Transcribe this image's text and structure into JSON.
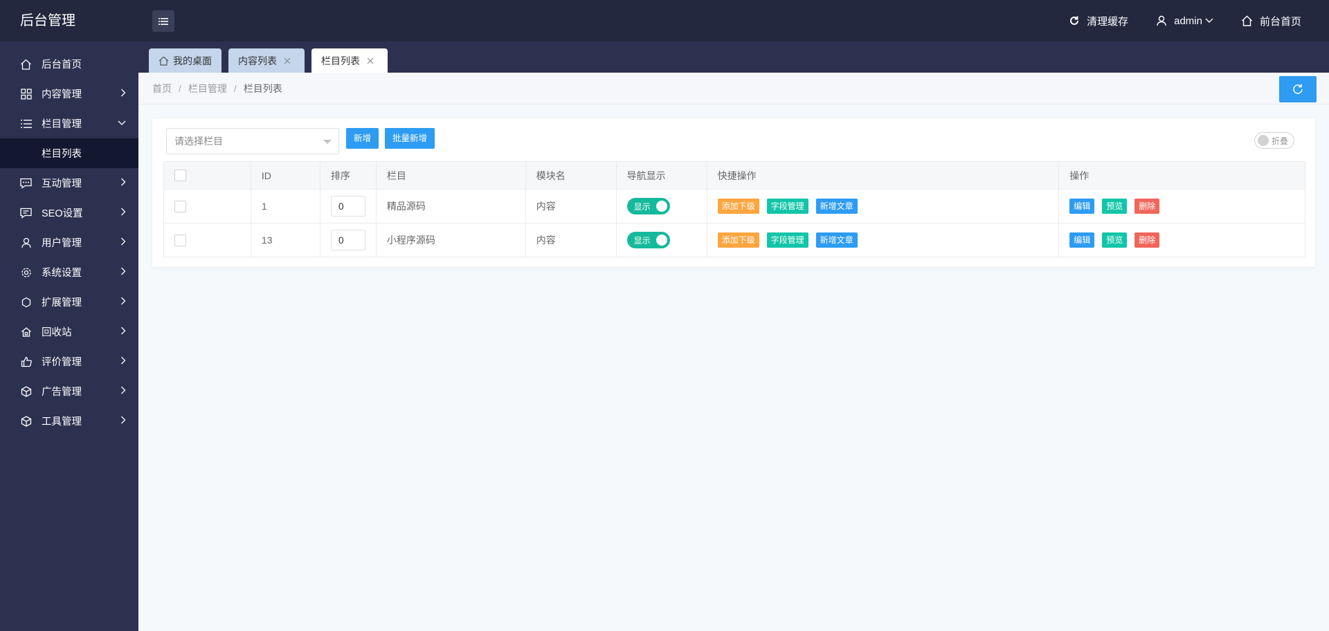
{
  "brand": "后台管理",
  "topbar": {
    "clear_cache": "清理缓存",
    "user": "admin",
    "front_home": "前台首页"
  },
  "sidebar": {
    "items": [
      {
        "label": "后台首页",
        "icon": "home-icon"
      },
      {
        "label": "内容管理",
        "icon": "grid-icon"
      },
      {
        "label": "栏目管理",
        "icon": "list-icon"
      },
      {
        "label": "互动管理",
        "icon": "chat-icon"
      },
      {
        "label": "SEO设置",
        "icon": "comment-icon"
      },
      {
        "label": "用户管理",
        "icon": "user-icon"
      },
      {
        "label": "系统设置",
        "icon": "gear-icon"
      },
      {
        "label": "扩展管理",
        "icon": "extend-icon"
      },
      {
        "label": "回收站",
        "icon": "recycle-icon"
      },
      {
        "label": "评价管理",
        "icon": "thumb-icon"
      },
      {
        "label": "广告管理",
        "icon": "cube-icon"
      },
      {
        "label": "工具管理",
        "icon": "tool-icon"
      }
    ],
    "sub_item": "栏目列表"
  },
  "tabs": [
    {
      "label": "我的桌面"
    },
    {
      "label": "内容列表"
    },
    {
      "label": "栏目列表"
    }
  ],
  "breadcrumb": [
    "首页",
    "栏目管理",
    "栏目列表"
  ],
  "breadcrumb_sep": "/",
  "toolbar": {
    "select_placeholder": "请选择栏目",
    "add_label": "新增",
    "batch_add_label": "批量新增",
    "fold_label": "折叠"
  },
  "table": {
    "headers": [
      "ID",
      "排序",
      "栏目",
      "模块名",
      "导航显示",
      "快捷操作",
      "操作"
    ],
    "rows": [
      {
        "id": "1",
        "sort": "0",
        "name": "精品源码",
        "module": "内容",
        "nav": "显示"
      },
      {
        "id": "13",
        "sort": "0",
        "name": "小程序源码",
        "module": "内容",
        "nav": "显示"
      }
    ],
    "quick_actions": [
      "添加下级",
      "字段管理",
      "新增文章"
    ],
    "actions": [
      "编辑",
      "预览",
      "删除"
    ]
  },
  "colors": {
    "header_bg": "#23283f",
    "sidebar_bg": "#2d3150",
    "primary": "#2d9cf2",
    "teal": "#12c5a8",
    "orange": "#fca640",
    "red": "#f0665b"
  }
}
